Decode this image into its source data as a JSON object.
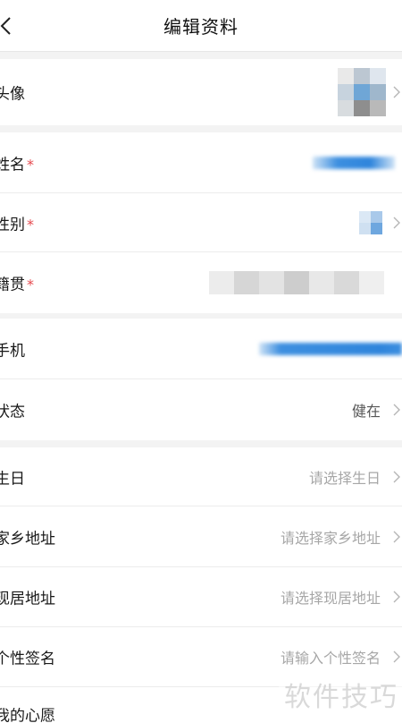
{
  "header": {
    "title": "编辑资料",
    "back_icon": "chevron-left-icon"
  },
  "groups": [
    [
      {
        "id": "avatar",
        "label": "头像",
        "required": false,
        "value": ""
      }
    ],
    [
      {
        "id": "name",
        "label": "姓名",
        "required": true,
        "value": ""
      },
      {
        "id": "gender",
        "label": "性别",
        "required": true,
        "value": ""
      },
      {
        "id": "native-place",
        "label": "籍贯",
        "required": true,
        "value": ""
      }
    ],
    [
      {
        "id": "phone",
        "label": "手机",
        "required": false,
        "value": ""
      },
      {
        "id": "status",
        "label": "状态",
        "required": false,
        "value": "健在"
      }
    ],
    [
      {
        "id": "birthday",
        "label": "生日",
        "required": false,
        "placeholder": "请选择生日"
      },
      {
        "id": "hometown",
        "label": "家乡地址",
        "required": false,
        "placeholder": "请选择家乡地址"
      },
      {
        "id": "current-address",
        "label": "现居地址",
        "required": false,
        "placeholder": "请选择现居地址"
      },
      {
        "id": "signature",
        "label": "个性签名",
        "required": false,
        "placeholder": "请输入个性签名"
      },
      {
        "id": "wish",
        "label": "我的心愿",
        "required": false,
        "placeholder": ""
      }
    ]
  ],
  "required_mark": "*",
  "watermark": "软件技巧",
  "colors": {
    "required": "#e5484d",
    "placeholder": "#a7a7a7",
    "background": "#f3f3f3"
  }
}
